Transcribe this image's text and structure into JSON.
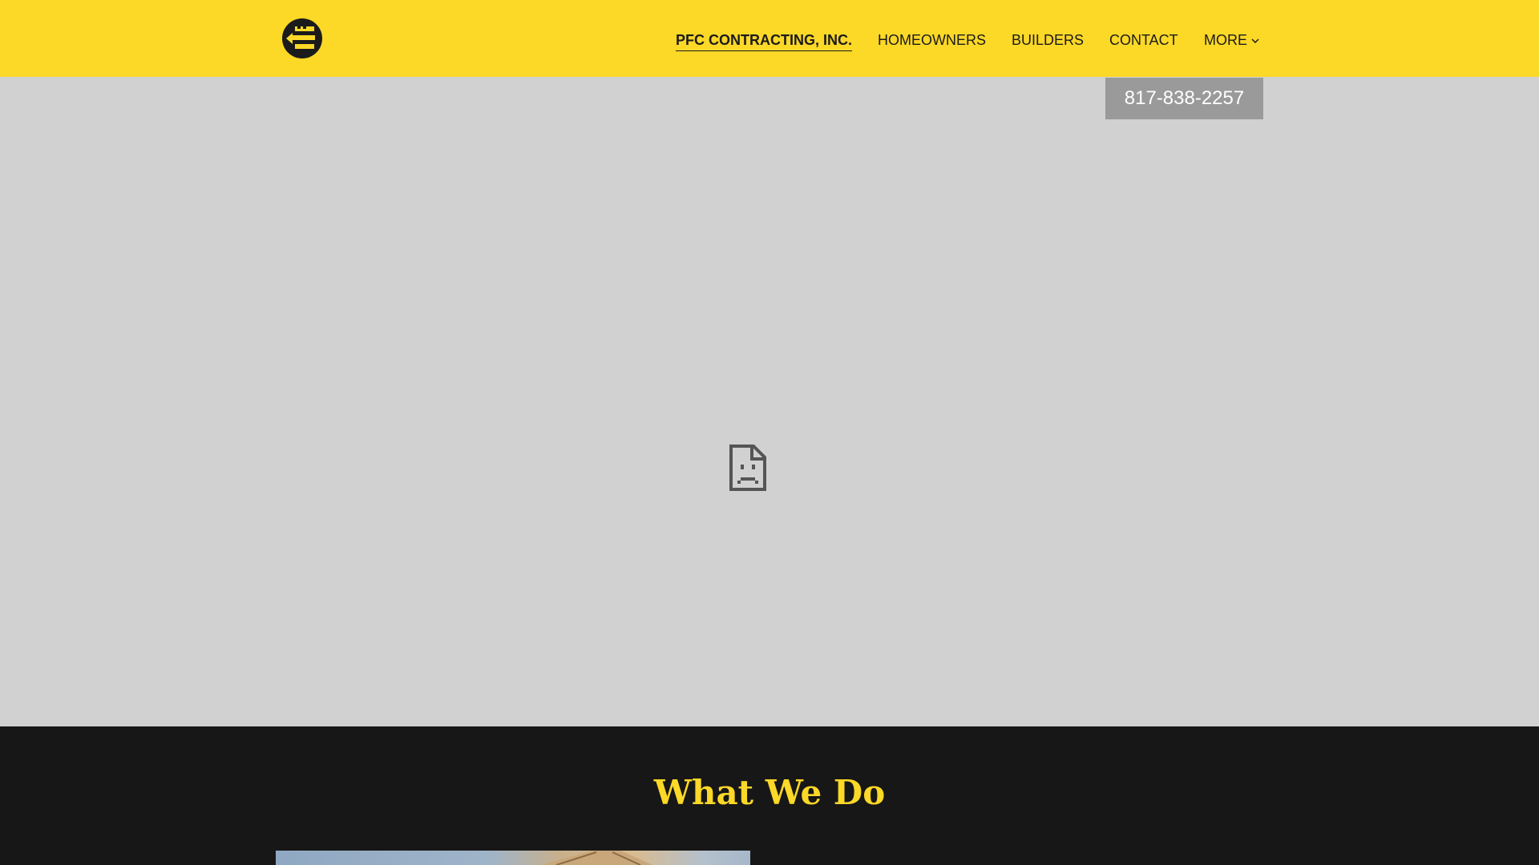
{
  "header": {
    "logo_alt": "PFC Contracting logo",
    "nav": [
      {
        "label": "PFC CONTRACTING, INC.",
        "active": true
      },
      {
        "label": "HOMEOWNERS",
        "active": false
      },
      {
        "label": "BUILDERS",
        "active": false
      },
      {
        "label": "CONTACT",
        "active": false
      },
      {
        "label": "MORE",
        "active": false,
        "dropdown": true
      }
    ]
  },
  "hero": {
    "phone": "817-838-2257",
    "media_state": "broken-image-icon"
  },
  "section": {
    "title": "What We Do"
  },
  "colors": {
    "brand_yellow": "#fcd827",
    "dark": "#171717",
    "hero_bg": "#d1d1d1",
    "button_gray": "#9a9a9a"
  }
}
